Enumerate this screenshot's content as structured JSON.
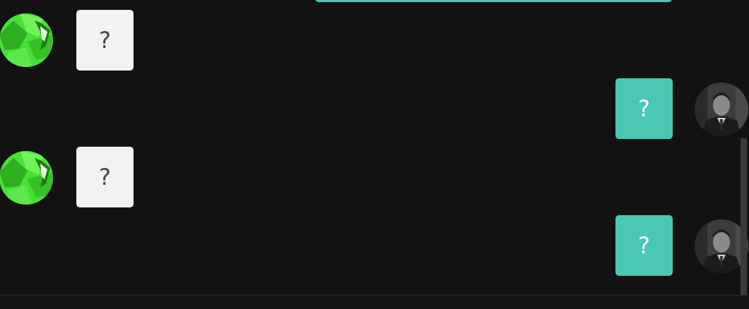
{
  "colors": {
    "background": "#121212",
    "incoming_bubble": "#f2f2f2",
    "outgoing_bubble": "#4ac8b4",
    "bot_avatar": "#47e035",
    "scrollbar": "#3a3a3a"
  },
  "messages": [
    {
      "sender": "bot",
      "text": "?",
      "avatar_icon": "bot-avatar-icon"
    },
    {
      "sender": "user",
      "text": "?",
      "avatar_icon": "user-avatar-icon"
    },
    {
      "sender": "bot",
      "text": "?",
      "avatar_icon": "bot-avatar-icon"
    },
    {
      "sender": "user",
      "text": "?",
      "avatar_icon": "user-avatar-icon"
    }
  ]
}
